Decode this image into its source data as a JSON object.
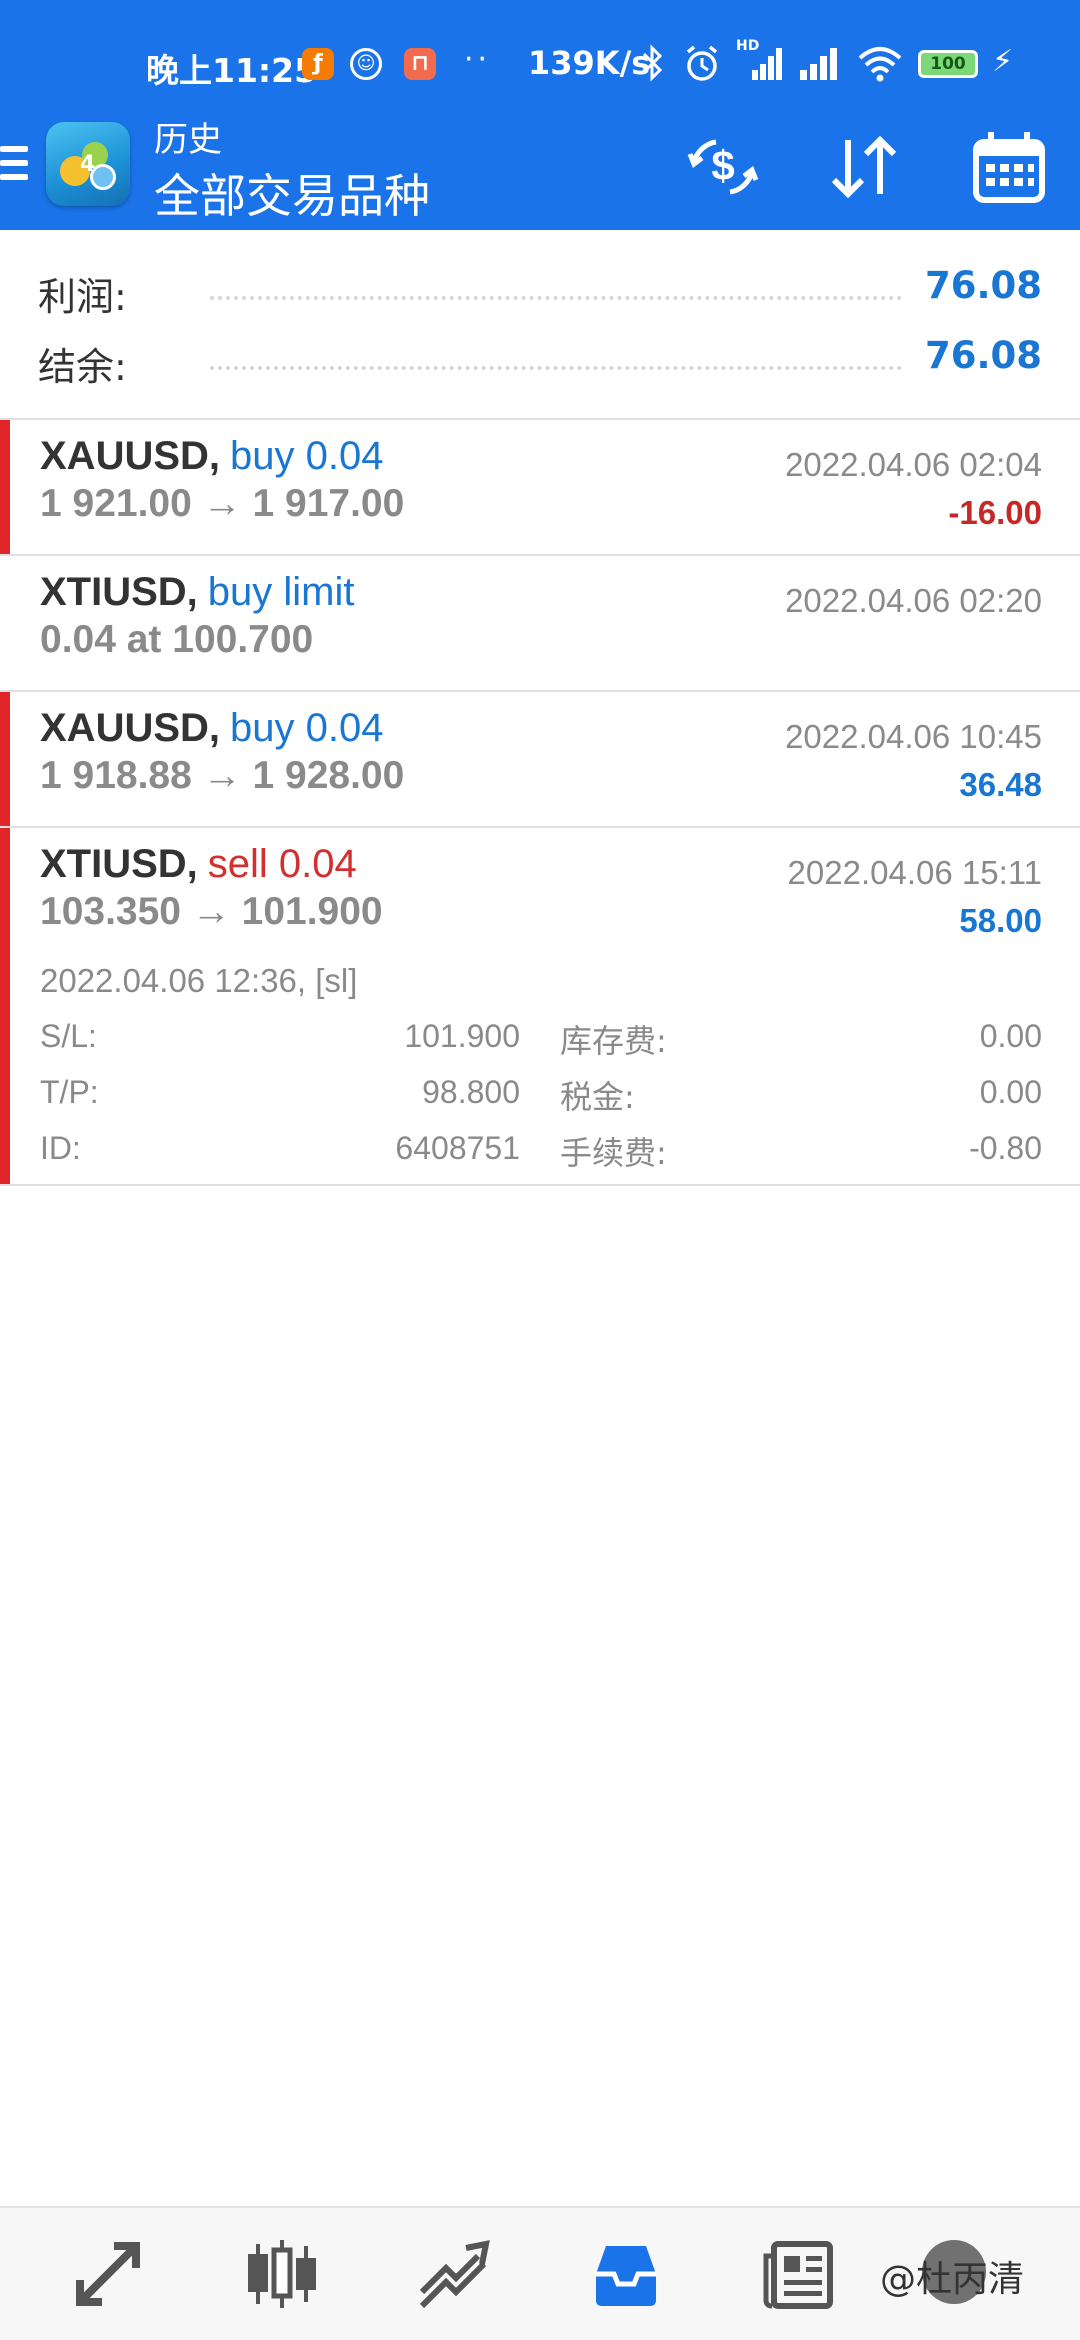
{
  "status_bar": {
    "time": "晚上11:25",
    "dots": "··",
    "net_speed": "139K/s",
    "battery": "100",
    "hd_label": "HD"
  },
  "header": {
    "title": "历史",
    "subtitle": "全部交易品种"
  },
  "summary": {
    "profit_label": "利润:",
    "profit_value": "76.08",
    "balance_label": "结余:",
    "balance_value": "76.08"
  },
  "deals": [
    {
      "symbol": "XAUUSD,",
      "type": "buy 0.04",
      "prices": "1 921.00 → 1 917.00",
      "time": "2022.04.06 02:04",
      "profit": "-16.00"
    },
    {
      "symbol": "XTIUSD,",
      "type": "buy limit",
      "prices": "0.04 at 100.700",
      "time": "2022.04.06 02:20",
      "profit": ""
    },
    {
      "symbol": "XAUUSD,",
      "type": "buy 0.04",
      "prices": "1 918.88 → 1 928.00",
      "time": "2022.04.06 10:45",
      "profit": "36.48"
    },
    {
      "symbol": "XTIUSD,",
      "type": "sell 0.04",
      "prices": "103.350 → 101.900",
      "time": "2022.04.06 15:11",
      "profit": "58.00",
      "open_info": "2022.04.06 12:36, [sl]",
      "details": {
        "sl_label": "S/L:",
        "sl_value": "101.900",
        "swap_label": "库存费:",
        "swap_value": "0.00",
        "tp_label": "T/P:",
        "tp_value": "98.800",
        "tax_label": "税金:",
        "tax_value": "0.00",
        "id_label": "ID:",
        "id_value": "6408751",
        "fee_label": "手续费:",
        "fee_value": "-0.80"
      }
    }
  ],
  "watermark": "@杜丙清",
  "colors": {
    "header_blue": "#1a73e8",
    "value_blue": "#1976d2",
    "loss_red": "#c62828",
    "marker_red": "#e0262b"
  },
  "icons": {
    "header": [
      "dollar-exchange-icon",
      "sort-icon",
      "calendar-icon"
    ],
    "nav": [
      "quotes-icon",
      "chart-icon",
      "trade-icon",
      "history-icon",
      "news-icon",
      "chat-icon"
    ]
  }
}
